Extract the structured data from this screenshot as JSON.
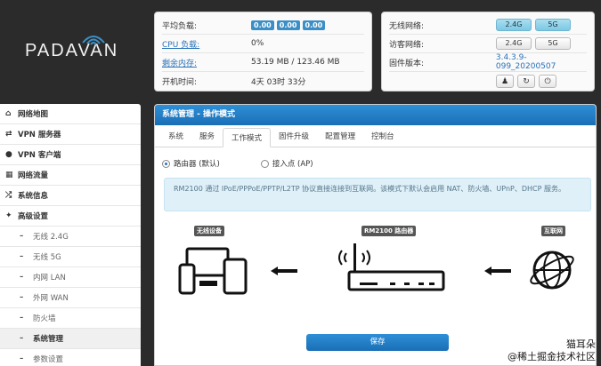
{
  "brand": {
    "logo_text": "PADAVAN"
  },
  "status_panel": {
    "rows": [
      {
        "label": "平均负载:",
        "values": [
          "0.00",
          "0.00",
          "0.00"
        ]
      },
      {
        "label": "CPU 负载:",
        "value": "0%"
      },
      {
        "label": "剩余内存:",
        "value": "53.19 MB / 123.46 MB"
      },
      {
        "label": "开机时间:",
        "value": "4天 03时 33分"
      }
    ]
  },
  "network_panel": {
    "wireless_label": "无线网络:",
    "guest_label": "访客网络:",
    "firmware_label": "固件版本:",
    "band_24": "2.4G",
    "band_5": "5G",
    "firmware_version": "3.4.3.9-099_20200507"
  },
  "sidebar": {
    "items": [
      {
        "label": "网络地图",
        "icon": "home-icon"
      },
      {
        "label": "VPN 服务器",
        "icon": "shuffle-icon"
      },
      {
        "label": "VPN 客户端",
        "icon": "globe-icon"
      },
      {
        "label": "网络流量",
        "icon": "chart-icon"
      },
      {
        "label": "系统信息",
        "icon": "shuffle-icon"
      },
      {
        "label": "高级设置",
        "icon": "wrench-icon"
      }
    ],
    "sub_items": [
      "无线 2.4G",
      "无线 5G",
      "内网 LAN",
      "外网 WAN",
      "防火墙",
      "系统管理",
      "参数设置"
    ]
  },
  "main": {
    "title": "系统管理 - 操作模式",
    "tabs": [
      "系统",
      "服务",
      "工作模式",
      "固件升级",
      "配置管理",
      "控制台"
    ],
    "active_tab": "工作模式",
    "radio_router": "路由器 (默认)",
    "radio_ap": "接入点 (AP)",
    "description": "RM2100 通过 IPoE/PPPoE/PPTP/L2TP 协议直接连接到互联网。该模式下默认会启用 NAT、防火墙、UPnP、DHCP 服务。",
    "diagram": {
      "left_label": "无线设备",
      "center_label": "RM2100 路由器",
      "right_label": "互联网"
    },
    "save_label": "保存"
  },
  "watermark": {
    "line1": "猫耳朵",
    "line2": "@稀土掘金技术社区"
  },
  "colors": {
    "accent": "#1f7cc4",
    "background": "#2b2b2b",
    "badge": "#3b8fc6"
  }
}
